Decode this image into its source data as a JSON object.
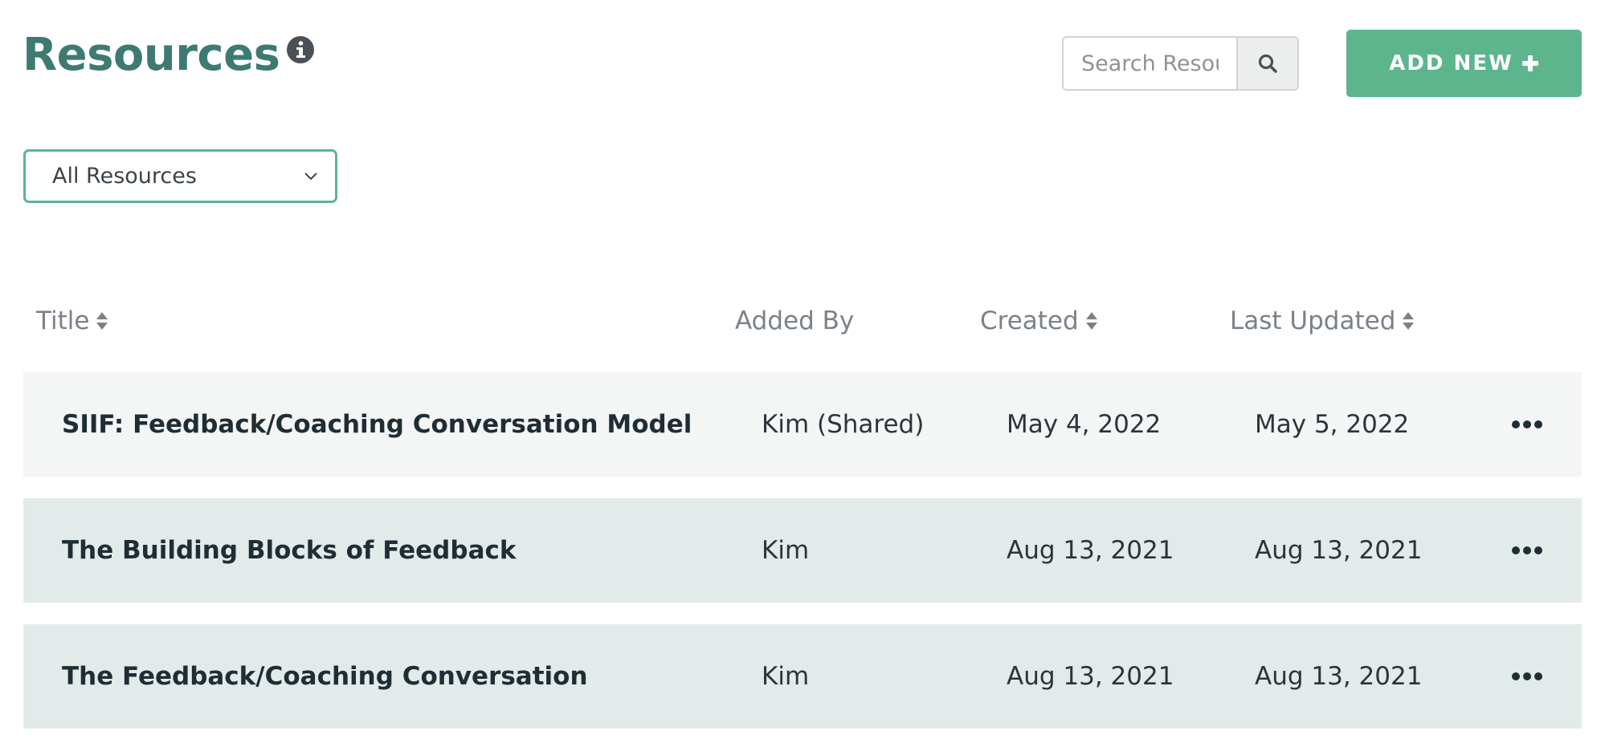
{
  "header": {
    "title": "Resources",
    "info_icon": "info-circle-icon",
    "search": {
      "placeholder": "Search Resources",
      "value": "",
      "button_icon": "search-icon"
    },
    "add_button": {
      "label": "ADD NEW",
      "icon": "plus-icon"
    }
  },
  "filter": {
    "selected": "All Resources",
    "icon": "chevron-down-icon"
  },
  "table": {
    "columns": [
      {
        "label": "Title",
        "sortable": true
      },
      {
        "label": "Added By",
        "sortable": false
      },
      {
        "label": "Created",
        "sortable": true
      },
      {
        "label": "Last Updated",
        "sortable": true
      }
    ],
    "rows": [
      {
        "title": "SIIF: Feedback/Coaching Conversation Model",
        "added_by": "Kim (Shared)",
        "created": "May 4, 2022",
        "last_updated": "May 5, 2022"
      },
      {
        "title": "The Building Blocks of Feedback",
        "added_by": "Kim",
        "created": "Aug 13, 2021",
        "last_updated": "Aug 13, 2021"
      },
      {
        "title": "The Feedback/Coaching Conversation",
        "added_by": "Kim",
        "created": "Aug 13, 2021",
        "last_updated": "Aug 13, 2021"
      }
    ],
    "row_menu_icon": "more-horizontal-icon"
  },
  "colors": {
    "title": "#3d7a72",
    "accent": "#5db58d",
    "row_light": "#f3f6f5",
    "row_dark": "#e3ebea",
    "header_text": "#7a8188"
  }
}
